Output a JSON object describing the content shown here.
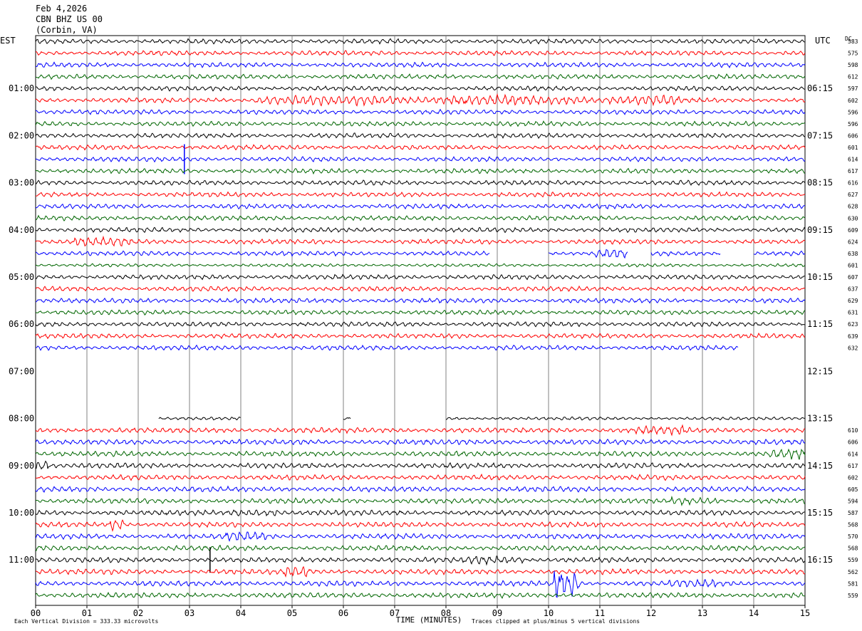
{
  "header": {
    "date": "Feb 4,2026",
    "station": "CBN BHZ US 00",
    "location": "(Corbin, VA)"
  },
  "left_timezone": "EST",
  "right_timezone": "UTC",
  "dc_label": "DC",
  "footer": {
    "scale_note": "Each Vertical Division =  333.33 microvolts",
    "x_title": "TIME (MINUTES)",
    "clip_note": "Traces clipped at plus/minus 5 vertical divisions"
  },
  "colors": {
    "trace_cycle": [
      "#000000",
      "#ff0000",
      "#0000ff",
      "#006600"
    ],
    "grid": "#808080"
  },
  "chart_data": {
    "type": "line",
    "xlabel": "TIME (MINUTES)",
    "x_ticks": [
      "00",
      "01",
      "02",
      "03",
      "04",
      "05",
      "06",
      "07",
      "08",
      "09",
      "10",
      "11",
      "12",
      "13",
      "14",
      "15"
    ],
    "xlim": [
      0,
      15
    ],
    "rows_per_hour": 4,
    "left_hour_labels": [
      {
        "label": "01:00",
        "row": 4
      },
      {
        "label": "02:00",
        "row": 8
      },
      {
        "label": "03:00",
        "row": 12
      },
      {
        "label": "04:00",
        "row": 16
      },
      {
        "label": "05:00",
        "row": 20
      },
      {
        "label": "06:00",
        "row": 24
      },
      {
        "label": "07:00",
        "row": 28
      },
      {
        "label": "08:00",
        "row": 32
      },
      {
        "label": "09:00",
        "row": 36
      },
      {
        "label": "10:00",
        "row": 40
      },
      {
        "label": "11:00",
        "row": 44
      }
    ],
    "right_hour_labels": [
      {
        "label": "06:15",
        "row": 4
      },
      {
        "label": "07:15",
        "row": 8
      },
      {
        "label": "08:15",
        "row": 12
      },
      {
        "label": "09:15",
        "row": 16
      },
      {
        "label": "10:15",
        "row": 20
      },
      {
        "label": "11:15",
        "row": 24
      },
      {
        "label": "12:15",
        "row": 28
      },
      {
        "label": "13:15",
        "row": 32
      },
      {
        "label": "14:15",
        "row": 36
      },
      {
        "label": "15:15",
        "row": 40
      },
      {
        "label": "16:15",
        "row": 44
      }
    ],
    "traces": [
      {
        "row": 0,
        "dc": "583",
        "segments": [
          [
            0,
            15
          ]
        ],
        "amp": 0.45
      },
      {
        "row": 1,
        "dc": "575",
        "segments": [
          [
            0,
            15
          ]
        ],
        "amp": 0.45
      },
      {
        "row": 2,
        "dc": "598",
        "segments": [
          [
            0,
            15
          ]
        ],
        "amp": 0.45
      },
      {
        "row": 3,
        "dc": "612",
        "segments": [
          [
            0,
            15
          ]
        ],
        "amp": 0.45
      },
      {
        "row": 4,
        "dc": "597",
        "segments": [
          [
            0,
            15
          ]
        ],
        "amp": 0.45
      },
      {
        "row": 5,
        "dc": "602",
        "segments": [
          [
            0,
            15
          ]
        ],
        "amp": 0.45,
        "bursts": [
          [
            8.4,
            8.3,
            2.2
          ]
        ]
      },
      {
        "row": 6,
        "dc": "596",
        "segments": [
          [
            0,
            15
          ]
        ],
        "amp": 0.45
      },
      {
        "row": 7,
        "dc": "596",
        "segments": [
          [
            0,
            15
          ]
        ],
        "amp": 0.45
      },
      {
        "row": 8,
        "dc": "606",
        "segments": [
          [
            0,
            15
          ]
        ],
        "amp": 0.45
      },
      {
        "row": 9,
        "dc": "601",
        "segments": [
          [
            0,
            15
          ]
        ],
        "amp": 0.45
      },
      {
        "row": 10,
        "dc": "614",
        "segments": [
          [
            0,
            15
          ]
        ],
        "amp": 0.45,
        "spikes": [
          [
            2.9,
            3.5
          ]
        ]
      },
      {
        "row": 11,
        "dc": "617",
        "segments": [
          [
            0,
            15
          ]
        ],
        "amp": 0.45
      },
      {
        "row": 12,
        "dc": "616",
        "segments": [
          [
            0,
            15
          ]
        ],
        "amp": 0.45
      },
      {
        "row": 13,
        "dc": "627",
        "segments": [
          [
            0,
            15
          ]
        ],
        "amp": 0.45
      },
      {
        "row": 14,
        "dc": "628",
        "segments": [
          [
            0,
            15
          ]
        ],
        "amp": 0.45
      },
      {
        "row": 15,
        "dc": "630",
        "segments": [
          [
            0,
            15
          ]
        ],
        "amp": 0.45
      },
      {
        "row": 16,
        "dc": "609",
        "segments": [
          [
            0,
            15
          ]
        ],
        "amp": 0.45
      },
      {
        "row": 17,
        "dc": "624",
        "segments": [
          [
            0,
            15
          ]
        ],
        "amp": 0.45,
        "bursts": [
          [
            1.3,
            1.1,
            2.0
          ]
        ]
      },
      {
        "row": 18,
        "dc": "638",
        "segments": [
          [
            0,
            8.85
          ],
          [
            10.0,
            11.55
          ],
          [
            12.0,
            13.35
          ],
          [
            14.0,
            15
          ]
        ],
        "amp": 0.45,
        "bursts": [
          [
            11.2,
            0.6,
            2.2
          ]
        ]
      },
      {
        "row": 19,
        "dc": "601",
        "segments": [
          [
            0,
            15
          ]
        ],
        "amp": 0.3
      },
      {
        "row": 20,
        "dc": "607",
        "segments": [
          [
            0,
            15
          ]
        ],
        "amp": 0.45
      },
      {
        "row": 21,
        "dc": "637",
        "segments": [
          [
            0,
            15
          ]
        ],
        "amp": 0.45
      },
      {
        "row": 22,
        "dc": "629",
        "segments": [
          [
            0,
            15
          ]
        ],
        "amp": 0.45
      },
      {
        "row": 23,
        "dc": "631",
        "segments": [
          [
            0,
            15
          ]
        ],
        "amp": 0.45
      },
      {
        "row": 24,
        "dc": "623",
        "segments": [
          [
            0,
            15
          ]
        ],
        "amp": 0.45
      },
      {
        "row": 25,
        "dc": "639",
        "segments": [
          [
            0,
            15
          ]
        ],
        "amp": 0.45
      },
      {
        "row": 26,
        "dc": "632",
        "segments": [
          [
            0,
            13.7
          ]
        ],
        "amp": 0.45
      },
      {
        "row": 32,
        "dc": "",
        "segments": [
          [
            2.4,
            4.0
          ],
          [
            6.0,
            6.15
          ],
          [
            8.0,
            15
          ]
        ],
        "amp": 0.3
      },
      {
        "row": 33,
        "dc": "610",
        "segments": [
          [
            0,
            15
          ]
        ],
        "amp": 0.5,
        "bursts": [
          [
            12.2,
            1.0,
            1.8
          ]
        ]
      },
      {
        "row": 34,
        "dc": "606",
        "segments": [
          [
            0,
            15
          ]
        ],
        "amp": 0.5
      },
      {
        "row": 35,
        "dc": "614",
        "segments": [
          [
            0,
            15
          ]
        ],
        "amp": 0.5,
        "bursts": [
          [
            14.7,
            0.8,
            2.0
          ]
        ]
      },
      {
        "row": 36,
        "dc": "617",
        "segments": [
          [
            0,
            15
          ]
        ],
        "amp": 0.5,
        "bursts": [
          [
            0.1,
            0.3,
            3.0
          ]
        ]
      },
      {
        "row": 37,
        "dc": "602",
        "segments": [
          [
            0,
            15
          ]
        ],
        "amp": 0.5
      },
      {
        "row": 38,
        "dc": "605",
        "segments": [
          [
            0,
            15
          ]
        ],
        "amp": 0.5
      },
      {
        "row": 39,
        "dc": "594",
        "segments": [
          [
            0,
            15
          ]
        ],
        "amp": 0.5,
        "bursts": [
          [
            12.9,
            1.0,
            1.7
          ]
        ]
      },
      {
        "row": 40,
        "dc": "587",
        "segments": [
          [
            0,
            15
          ]
        ],
        "amp": 0.5,
        "bursts": [
          [
            4.3,
            0.9,
            2.0
          ]
        ]
      },
      {
        "row": 41,
        "dc": "568",
        "segments": [
          [
            0,
            15
          ]
        ],
        "amp": 0.5,
        "bursts": [
          [
            1.6,
            0.3,
            3.0
          ]
        ]
      },
      {
        "row": 42,
        "dc": "570",
        "segments": [
          [
            0,
            15
          ]
        ],
        "amp": 0.5,
        "bursts": [
          [
            4.1,
            0.8,
            1.8
          ]
        ]
      },
      {
        "row": 43,
        "dc": "568",
        "segments": [
          [
            0,
            15
          ]
        ],
        "amp": 0.5
      },
      {
        "row": 44,
        "dc": "559",
        "segments": [
          [
            0,
            15
          ]
        ],
        "amp": 0.5,
        "bursts": [
          [
            8.9,
            1.2,
            1.8
          ]
        ],
        "spikes": [
          [
            3.4,
            3.0
          ]
        ]
      },
      {
        "row": 45,
        "dc": "562",
        "segments": [
          [
            0,
            15
          ]
        ],
        "amp": 0.5,
        "bursts": [
          [
            5.1,
            0.6,
            2.2
          ]
        ]
      },
      {
        "row": 46,
        "dc": "581",
        "segments": [
          [
            0,
            15
          ]
        ],
        "amp": 0.5,
        "bursts": [
          [
            10.35,
            0.5,
            6.0
          ],
          [
            12.8,
            0.9,
            1.6
          ]
        ]
      },
      {
        "row": 47,
        "dc": "559",
        "segments": [
          [
            0,
            15
          ]
        ],
        "amp": 0.5
      }
    ]
  }
}
